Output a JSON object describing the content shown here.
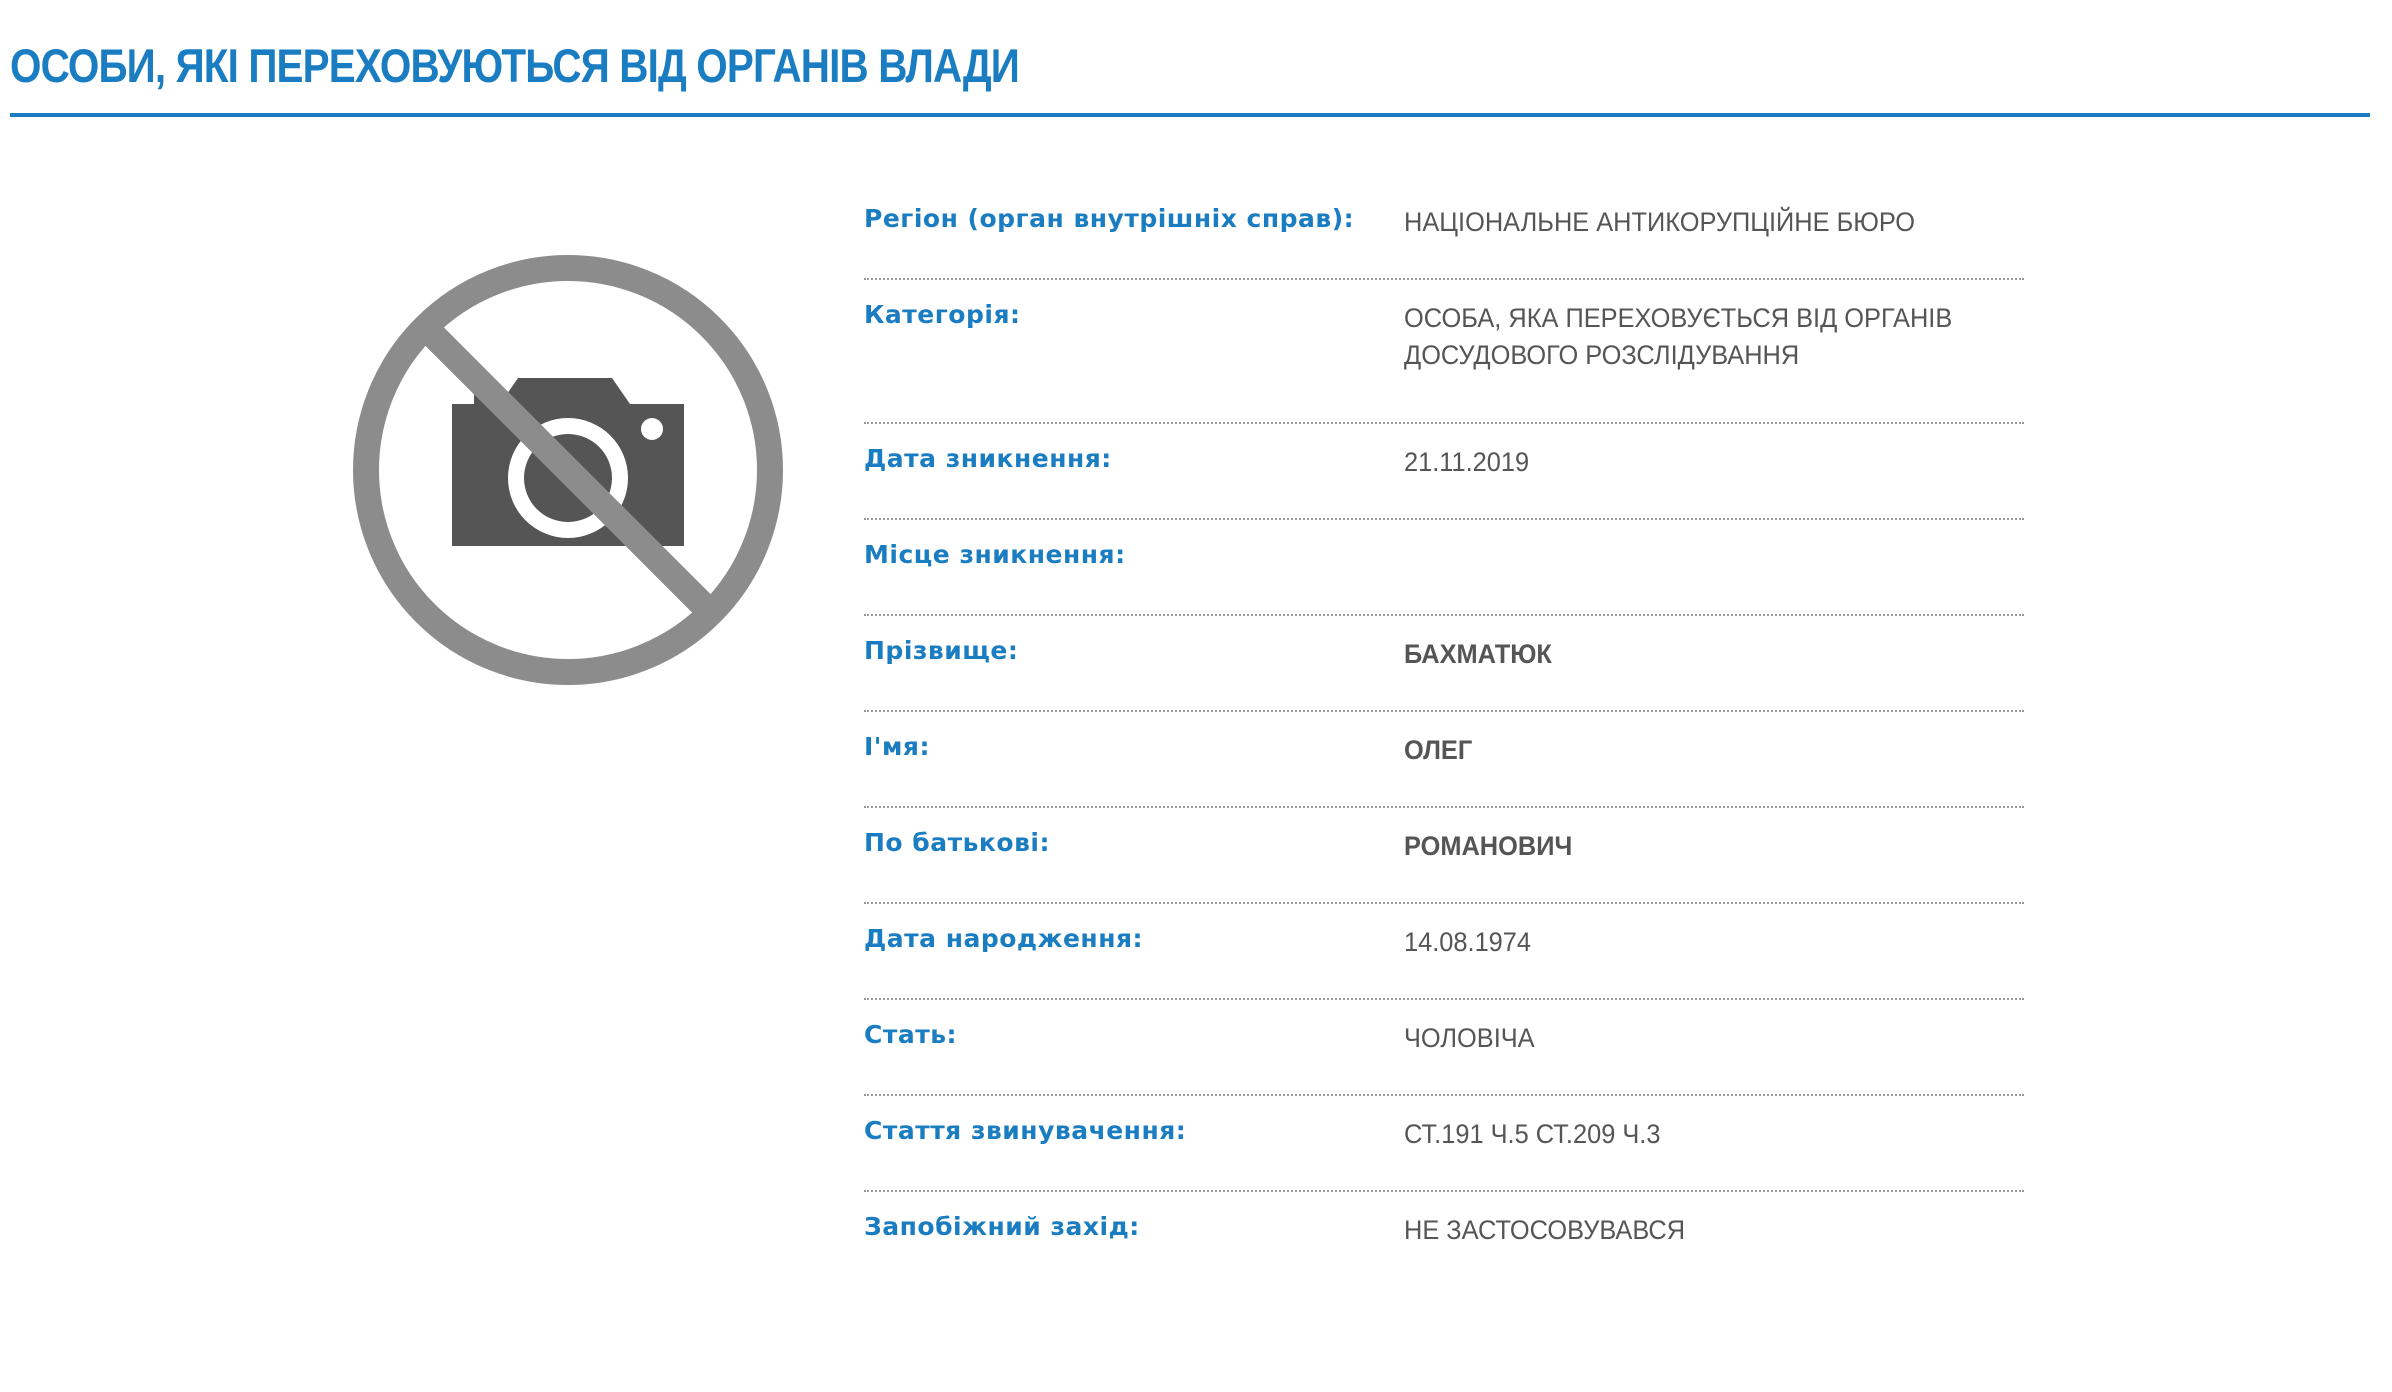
{
  "header": {
    "title": "ОСОБИ, ЯКІ ПЕРЕХОВУЮТЬСЯ ВІД ОРГАНІВ ВЛАДИ"
  },
  "photo": {
    "icon": "no-photo-icon",
    "color": "#8c8c8c",
    "camera_color": "#555555"
  },
  "details": [
    {
      "label": "Регіон (орган внутрішніх справ):",
      "value": "НАЦІОНАЛЬНЕ АНТИКОРУПЦІЙНЕ БЮРО"
    },
    {
      "label": "Категорія:",
      "value": "ОСОБА, ЯКА ПЕРЕХОВУЄТЬСЯ ВІД ОРГАНІВ ДОСУДОВОГО РОЗСЛІДУВАННЯ"
    },
    {
      "label": "Дата зникнення:",
      "value": "21.11.2019"
    },
    {
      "label": "Місце зникнення:",
      "value": ""
    },
    {
      "label": "Прізвище:",
      "value": "БАХМАТЮК"
    },
    {
      "label": "І'мя:",
      "value": "ОЛЕГ"
    },
    {
      "label": "По батькові:",
      "value": "РОМАНОВИЧ"
    },
    {
      "label": "Дата народження:",
      "value": "14.08.1974"
    },
    {
      "label": "Стать:",
      "value": "ЧОЛОВІЧА"
    },
    {
      "label": "Стаття звинувачення:",
      "value": "СТ.191 Ч.5 СТ.209 Ч.3"
    },
    {
      "label": "Запобіжний захід:",
      "value": "НЕ ЗАСТОСОВУВАВСЯ"
    }
  ],
  "colors": {
    "accent": "#1a7cc1",
    "text": "#555555"
  }
}
